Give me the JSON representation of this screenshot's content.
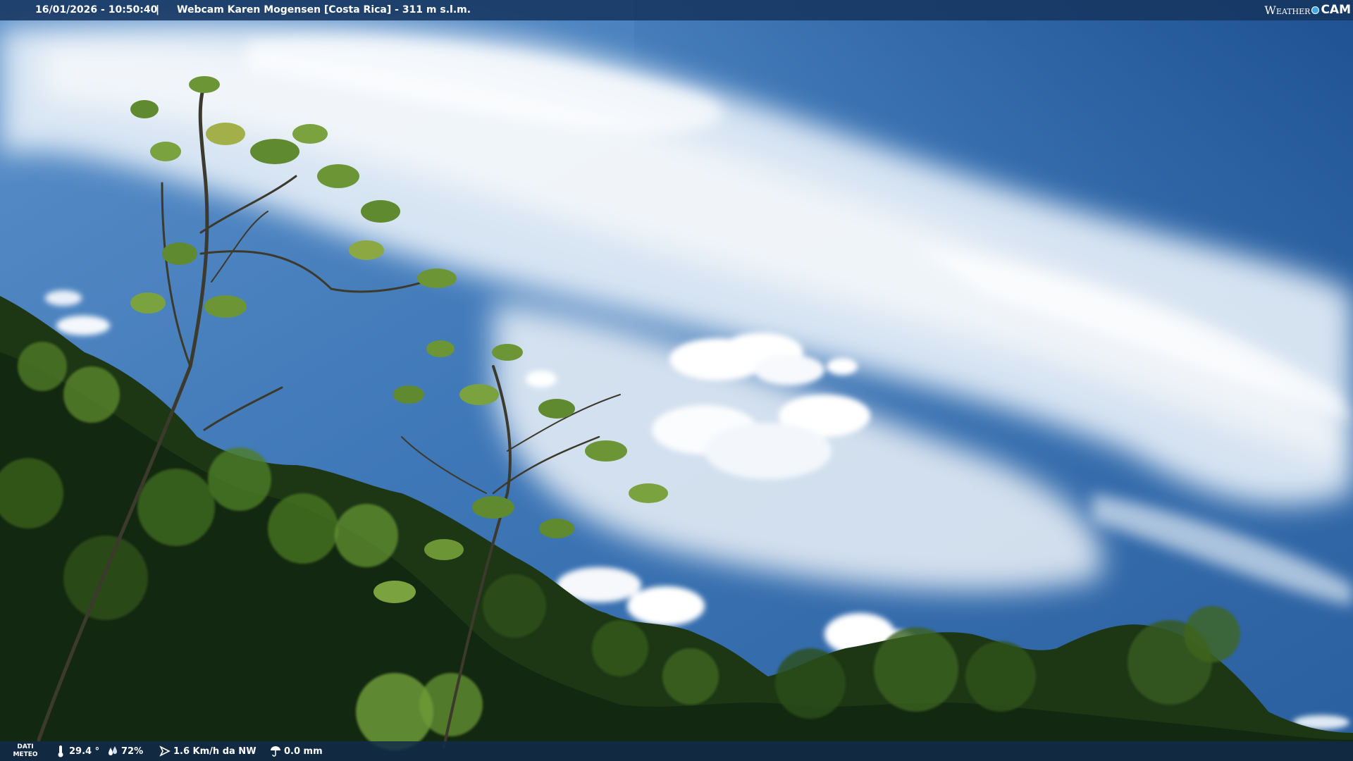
{
  "header": {
    "datetime": "16/01/2026 - 10:50:40",
    "separator": "|",
    "caption": "Webcam Karen Mogensen [Costa Rica] - 311 m s.l.m."
  },
  "logo": {
    "weather": "Weather",
    "cam": "CAM"
  },
  "weather_bar": {
    "label_line1": "DATI",
    "label_line2": "METEO",
    "temperature": "29.4 °",
    "humidity": "72%",
    "wind": "1.6 Km/h da NW",
    "rain": "0.0 mm"
  },
  "colors": {
    "sky_top": "#1f5596",
    "sky_mid": "#4d86c2",
    "cloud": "#ffffff",
    "foliage_dark": "#1f3a14",
    "foliage_light": "#6f9a34",
    "bar": "#163660"
  }
}
